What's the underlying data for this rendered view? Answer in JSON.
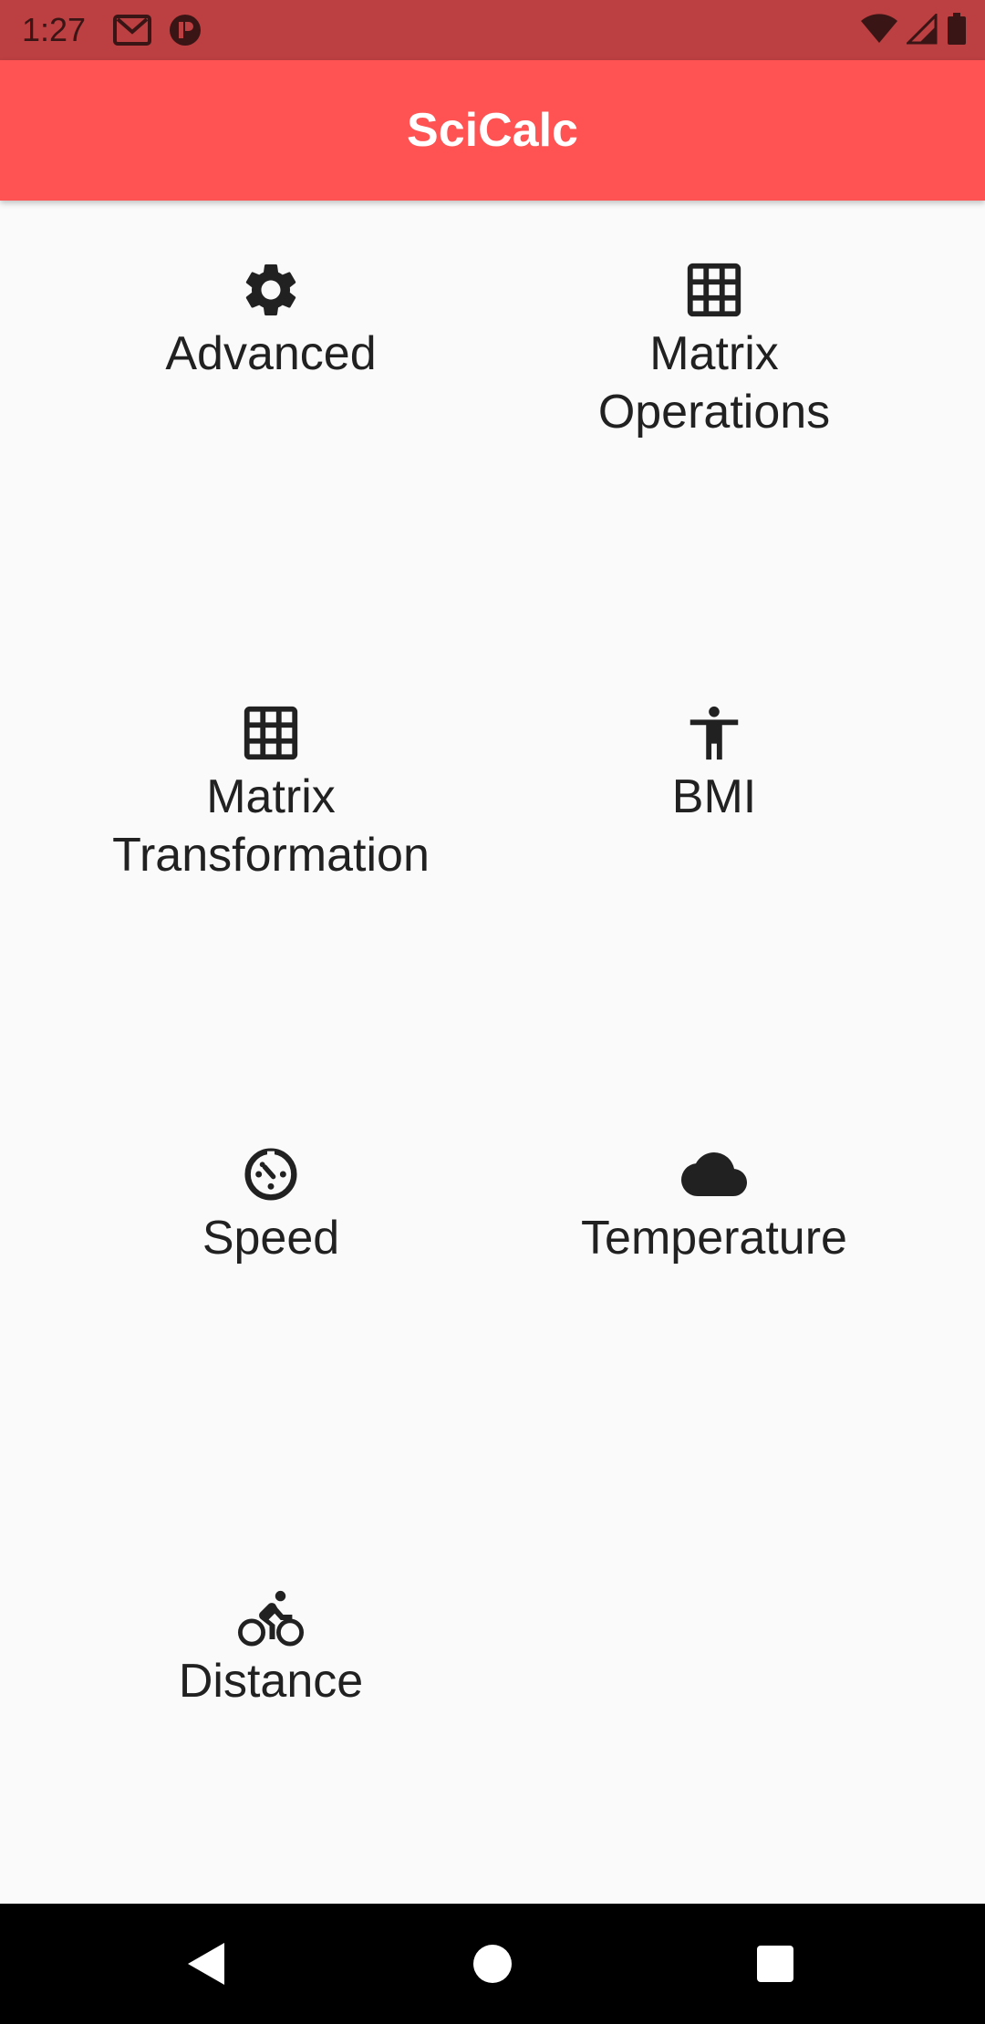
{
  "status_bar": {
    "time": "1:27",
    "left_icons": [
      "gmail-icon",
      "app-notification-icon"
    ],
    "right_icons": [
      "wifi-icon",
      "cell-signal-icon",
      "battery-icon"
    ]
  },
  "app_bar": {
    "title": "SciCalc",
    "color": "#ff5252"
  },
  "tiles": [
    {
      "label": "Advanced",
      "icon": "gear-icon"
    },
    {
      "label": "Matrix\nOperations",
      "icon": "grid-icon"
    },
    {
      "label": "Matrix\nTransformation",
      "icon": "grid-icon"
    },
    {
      "label": "BMI",
      "icon": "person-icon"
    },
    {
      "label": "Speed",
      "icon": "speedometer-icon"
    },
    {
      "label": "Temperature",
      "icon": "cloud-icon"
    },
    {
      "label": "Distance",
      "icon": "bicycle-icon"
    }
  ],
  "nav_bar": {
    "buttons": [
      "back-icon",
      "home-icon",
      "recents-icon"
    ]
  }
}
